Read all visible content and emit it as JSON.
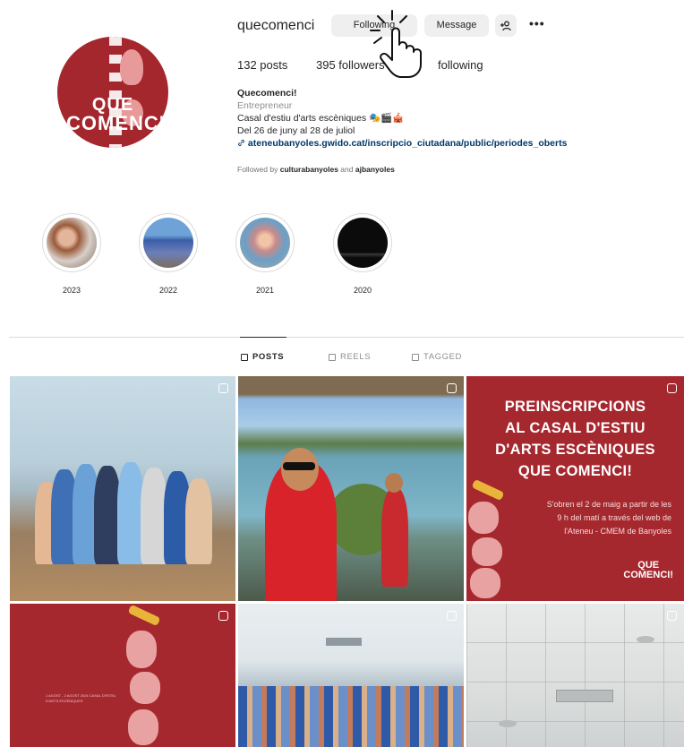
{
  "profile": {
    "username": "quecomenci",
    "avatar_logo_line1": "QUE",
    "avatar_logo_line2": "COMENCI!"
  },
  "actions": {
    "follow_label": "Following",
    "message_label": "Message",
    "add_user_icon": "person-plus-icon",
    "more_icon": "more-horizontal-icon"
  },
  "stats": {
    "posts": "132 posts",
    "followers": "395 followers",
    "following": "following"
  },
  "bio": {
    "name": "Quecomenci!",
    "category": "Entrepreneur",
    "line1": "Casal d'estiu d'arts escèniques 🎭🎬🎪",
    "line2": "Del 26 de juny al 28 de juliol",
    "link": "ateneubanyoles.gwido.cat/inscripcio_ciutadana/public/periodes_oberts"
  },
  "followed_by": {
    "prefix": "Followed by",
    "user1": "culturabanyoles",
    "and": "and",
    "user2": "ajbanyoles"
  },
  "highlights": [
    {
      "label": "2023"
    },
    {
      "label": "2022"
    },
    {
      "label": "2021"
    },
    {
      "label": "2020"
    }
  ],
  "tabs": {
    "posts": "POSTS",
    "reels": "REELS",
    "tagged": "TAGGED"
  },
  "posts": {
    "p3_title1": "PREINSCRIPCIONS",
    "p3_title2": "AL CASAL D'ESTIU",
    "p3_title3": "D'ARTS ESCÈNIQUES",
    "p3_title4": "QUE COMENCI!",
    "p3_desc1": "S'obren el 2 de maig a partir de les",
    "p3_desc2": "9 h del matí a través del web de",
    "p3_desc3": "l'Ateneu - CMEM de Banyoles",
    "p3_brand1": "QUE",
    "p3_brand2": "COMENCI!",
    "p4_text": "1 AGOST - 2 AGOST 2024 CASAL D'ESTIU D'ARTS ESCÈNIQUES"
  },
  "colors": {
    "brand_red": "#a6282f",
    "link_blue": "#00376b"
  }
}
